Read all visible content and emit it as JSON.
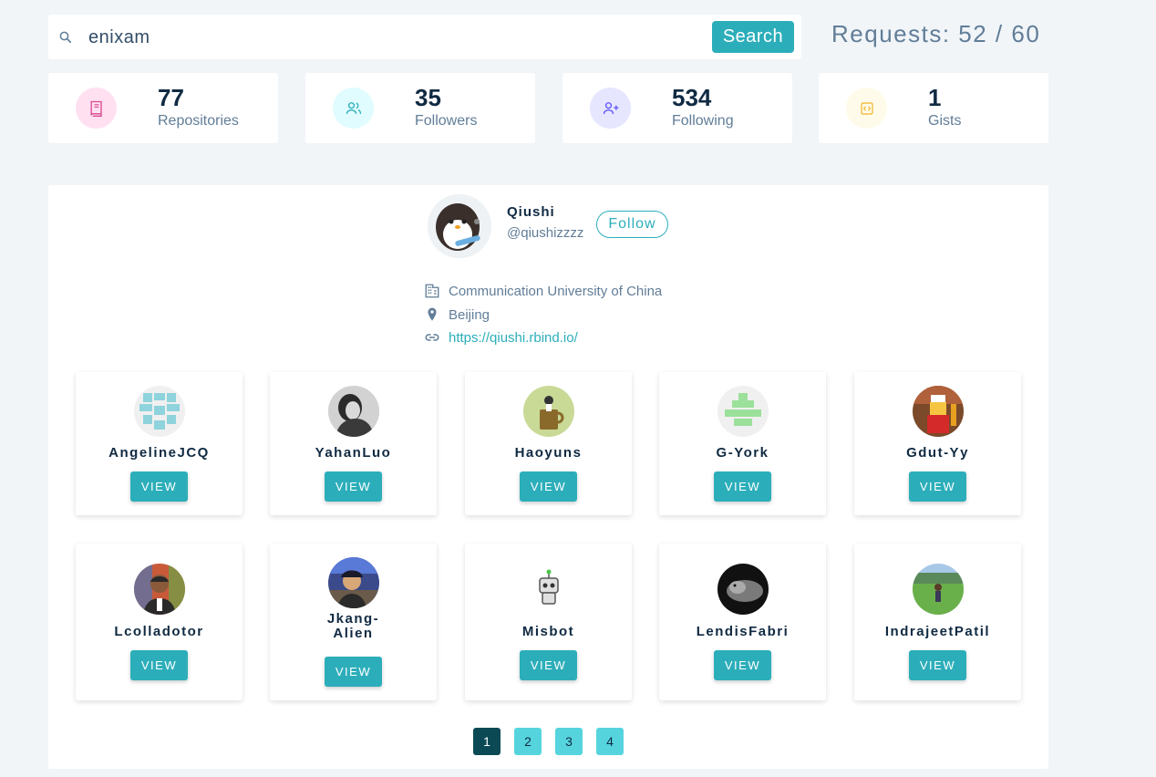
{
  "search": {
    "value": "enixam",
    "button_label": "Search"
  },
  "requests": {
    "label": "Requests: 52 / 60"
  },
  "stats": [
    {
      "value": "77",
      "label": "Repositories",
      "icon": "book-icon",
      "color": "#da4a91",
      "bg": "#ffe0f0"
    },
    {
      "value": "35",
      "label": "Followers",
      "icon": "users-icon",
      "color": "#2caeba",
      "bg": "#e0fcff"
    },
    {
      "value": "534",
      "label": "Following",
      "icon": "user-plus-icon",
      "color": "#5d55fa",
      "bg": "#e6e6ff"
    },
    {
      "value": "1",
      "label": "Gists",
      "icon": "code-icon",
      "color": "#f0b429",
      "bg": "#fffbea"
    }
  ],
  "profile": {
    "name": "Qiushi",
    "login": "@qiushizzzz",
    "follow_label": "Follow",
    "company": "Communication University of China",
    "location": "Beijing",
    "blog": "https://qiushi.rbind.io/"
  },
  "followers": [
    {
      "name": "AngelineJCQ",
      "view_label": "VIEW",
      "avatar": "identicon-teal"
    },
    {
      "name": "YahanLuo",
      "view_label": "VIEW",
      "avatar": "photo-grayscale"
    },
    {
      "name": "Haoyuns",
      "view_label": "VIEW",
      "avatar": "illustration-cup"
    },
    {
      "name": "G-York",
      "view_label": "VIEW",
      "avatar": "identicon-green"
    },
    {
      "name": "Gdut-Yy",
      "view_label": "VIEW",
      "avatar": "photo-lego"
    },
    {
      "name": "Lcolladotor",
      "view_label": "VIEW",
      "avatar": "photo-person"
    },
    {
      "name": "Jkang-Alien",
      "view_label": "VIEW",
      "avatar": "photo-person-stadium"
    },
    {
      "name": "Misbot",
      "view_label": "VIEW",
      "avatar": "robot"
    },
    {
      "name": "LendisFabri",
      "view_label": "VIEW",
      "avatar": "photo-dark-animal"
    },
    {
      "name": "IndrajeetPatil",
      "view_label": "VIEW",
      "avatar": "photo-field"
    }
  ],
  "pagination": {
    "pages": [
      "1",
      "2",
      "3",
      "4"
    ],
    "active": "1"
  },
  "colors": {
    "accent": "#2caeba",
    "active_page": "#0b4a55",
    "page": "#56d4de"
  }
}
